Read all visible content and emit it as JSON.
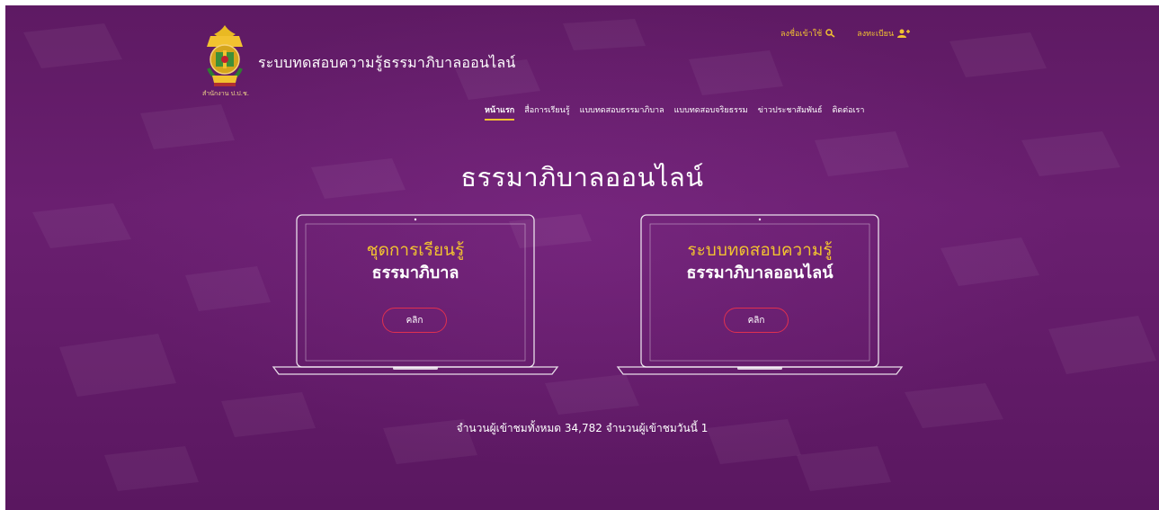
{
  "header": {
    "site_title": "ระบบทดสอบความรู้ธรรมาภิบาลออนไลน์",
    "logo_caption": "สำนักงาน ป.ป.ช.",
    "login_label": "ลงชื่อเข้าใช้",
    "register_label": "ลงทะเบียน"
  },
  "nav": {
    "items": [
      {
        "label": "หน้าแรก"
      },
      {
        "label": "สื่อการเรียนรู้"
      },
      {
        "label": "แบบทดสอบธรรมาภิบาล"
      },
      {
        "label": "แบบทดสอบจริยธรรม"
      },
      {
        "label": "ข่าวประชาสัมพันธ์"
      },
      {
        "label": "ติดต่อเรา"
      }
    ]
  },
  "hero": {
    "title": "ธรรมาภิบาลออนไลน์"
  },
  "cards": [
    {
      "line1": "ชุดการเรียนรู้",
      "line2": "ธรรมาภิบาล",
      "button": "คลิก"
    },
    {
      "line1": "ระบบทดสอบความรู้",
      "line2": "ธรรมาภิบาลออนไลน์",
      "button": "คลิก"
    }
  ],
  "footer": {
    "visitors": "จำนวนผู้เข้าชมทั้งหมด 34,782 จำนวนผู้เข้าชมวันนี้ 1"
  },
  "colors": {
    "background": "#6a1f70",
    "accent": "#f2c230",
    "button_border": "#e0304f",
    "text": "#ffffff"
  },
  "icons": {
    "login": "search-key-icon",
    "register": "user-add-icon"
  }
}
